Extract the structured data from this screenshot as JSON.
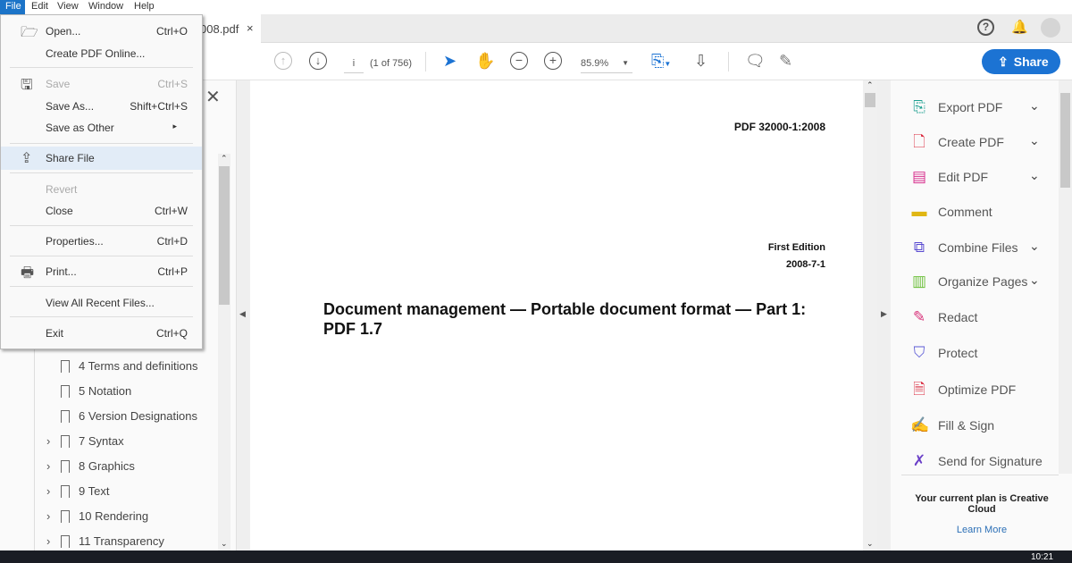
{
  "menubar": {
    "items": [
      "File",
      "Edit",
      "View",
      "Window",
      "Help"
    ]
  },
  "tab": {
    "title": "008.pdf",
    "close": "×"
  },
  "toolbar": {
    "page_input": "i",
    "page_count": "(1 of 756)",
    "zoom": "85.9%",
    "share_label": "Share"
  },
  "file_menu": [
    {
      "label": "Open...",
      "shortcut": "Ctrl+O",
      "icon": "folder-icon"
    },
    {
      "label": "Create PDF Online..."
    },
    {
      "label": "Save",
      "shortcut": "Ctrl+S",
      "icon": "save-icon",
      "disabled": true
    },
    {
      "label": "Save As...",
      "shortcut": "Shift+Ctrl+S"
    },
    {
      "label": "Save as Other",
      "submenu": "▸"
    },
    {
      "label": "Share File",
      "icon": "share-icon",
      "highlighted": true
    },
    {
      "label": "Revert",
      "disabled": true
    },
    {
      "label": "Close",
      "shortcut": "Ctrl+W"
    },
    {
      "label": "Properties...",
      "shortcut": "Ctrl+D"
    },
    {
      "label": "Print...",
      "shortcut": "Ctrl+P",
      "icon": "printer-icon"
    },
    {
      "label": "View All Recent Files..."
    },
    {
      "label": "Exit",
      "shortcut": "Ctrl+Q"
    }
  ],
  "bookmarks": [
    {
      "label": "4 Terms and definitions",
      "expandable": false
    },
    {
      "label": "5 Notation",
      "expandable": false
    },
    {
      "label": "6 Version Designations",
      "expandable": false
    },
    {
      "label": "7 Syntax",
      "expandable": true
    },
    {
      "label": "8 Graphics",
      "expandable": true
    },
    {
      "label": "9 Text",
      "expandable": true
    },
    {
      "label": "10 Rendering",
      "expandable": true
    },
    {
      "label": "11 Transparency",
      "expandable": true
    }
  ],
  "document": {
    "code": "PDF 32000-1:2008",
    "edition": "First Edition",
    "date": "2008-7-1",
    "title": "Document management — Portable document format — Part 1: PDF 1.7"
  },
  "tools": [
    {
      "label": "Export PDF",
      "icon": "export-pdf-icon",
      "color": "#1a9e8f",
      "dropdown": true
    },
    {
      "label": "Create PDF",
      "icon": "create-pdf-icon",
      "color": "#d9263b",
      "dropdown": true
    },
    {
      "label": "Edit PDF",
      "icon": "edit-pdf-icon",
      "color": "#d8328f",
      "dropdown": true
    },
    {
      "label": "Comment",
      "icon": "comment-icon",
      "color": "#e0b613",
      "dropdown": false
    },
    {
      "label": "Combine Files",
      "icon": "combine-files-icon",
      "color": "#5a4bd1",
      "dropdown": true
    },
    {
      "label": "Organize Pages",
      "icon": "organize-pages-icon",
      "color": "#6cbf3a",
      "dropdown": true
    },
    {
      "label": "Redact",
      "icon": "redact-icon",
      "color": "#d8327a",
      "dropdown": false
    },
    {
      "label": "Protect",
      "icon": "protect-icon",
      "color": "#5c5bd6",
      "dropdown": false
    },
    {
      "label": "Optimize PDF",
      "icon": "optimize-pdf-icon",
      "color": "#d9263b",
      "dropdown": false
    },
    {
      "label": "Fill & Sign",
      "icon": "fill-sign-icon",
      "color": "#8a4fd0",
      "dropdown": false
    },
    {
      "label": "Send for Signature",
      "icon": "send-signature-icon",
      "color": "#6a3fc8",
      "dropdown": false
    }
  ],
  "plan": {
    "text": "Your current plan is Creative Cloud",
    "link": "Learn More"
  },
  "taskbar": {
    "time": "10:21"
  },
  "colors": {
    "accent": "#1c73d3"
  }
}
